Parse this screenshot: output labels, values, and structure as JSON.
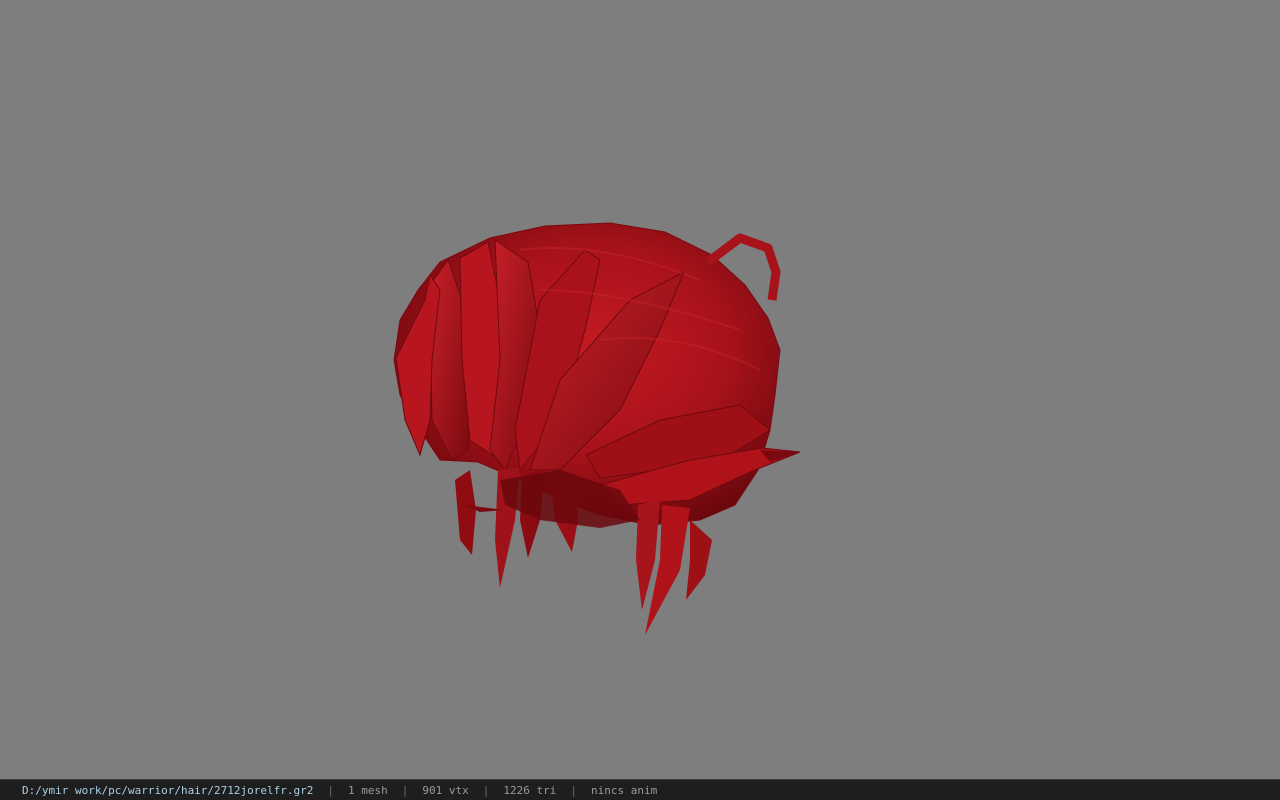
{
  "viewport": {
    "background": "#7e7e7e",
    "model_color": "#b0121a",
    "model_shade": "#6e0a0f"
  },
  "statusbar": {
    "file_path": "D:/ymir work/pc/warrior/hair/2712jorelfr.gr2",
    "mesh": "1 mesh",
    "vtx": "901 vtx",
    "tri": "1226 tri",
    "anim": "nincs anim"
  }
}
